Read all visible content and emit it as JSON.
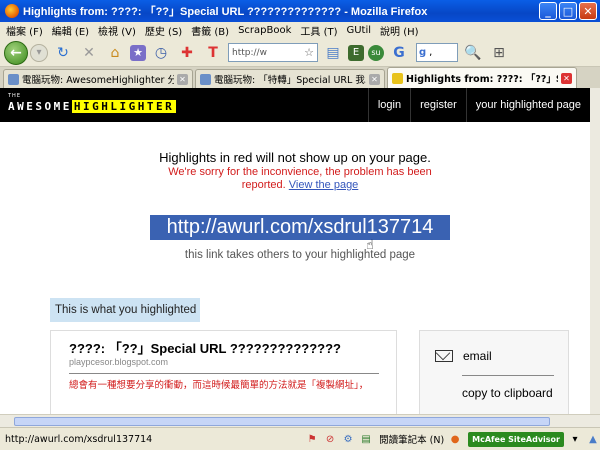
{
  "window": {
    "title": "Highlights from: ????: 「??」Special URL ?????????????? - Mozilla Firefox",
    "minimize": "_",
    "maximize": "□",
    "close": "✕"
  },
  "menu": [
    "檔案 (F)",
    "編輯 (E)",
    "檢視 (V)",
    "歷史 (S)",
    "書籤 (B)",
    "ScrapBook",
    "工具 (T)",
    "GUtil",
    "說明 (H)"
  ],
  "navbar": {
    "url": "http://w",
    "search_value": ","
  },
  "tabs": [
    {
      "label": "電腦玩物: AwesomeHighlighter 分享..."
    },
    {
      "label": "電腦玩物: 「特轉」Special URL 我..."
    },
    {
      "label": "Highlights from: ????: 「??」Sp..."
    }
  ],
  "site": {
    "logo_the": "THE",
    "logo_awesome": "AWESOME",
    "logo_highlighter": "HIGHLIGHTER",
    "nav": [
      "login",
      "register",
      "your highlighted page"
    ]
  },
  "message": {
    "title": "Highlights in red will not show up on your page.",
    "subtitle": "We're sorry for the inconvience, the problem has been reported.",
    "view_link": "View the page"
  },
  "short_url": "http://awurl.com/xsdrul137714",
  "link_note": "this link takes others to your highlighted page",
  "highlight": {
    "label": "This is what you highlighted",
    "title": "????: 「??」Special URL ??????????????",
    "domain": "playpcesor.blogspot.com",
    "text": "總會有一種想要分享的衝動，而這時候最簡單的方法就是「複製網址」，"
  },
  "share": {
    "email": "email",
    "copy": "copy to clipboard"
  },
  "status": {
    "url": "http://awurl.com/xsdrul137714",
    "notepad": "閱讀筆記本 (N)",
    "mcafee": "McAfee SiteAdvisor"
  }
}
